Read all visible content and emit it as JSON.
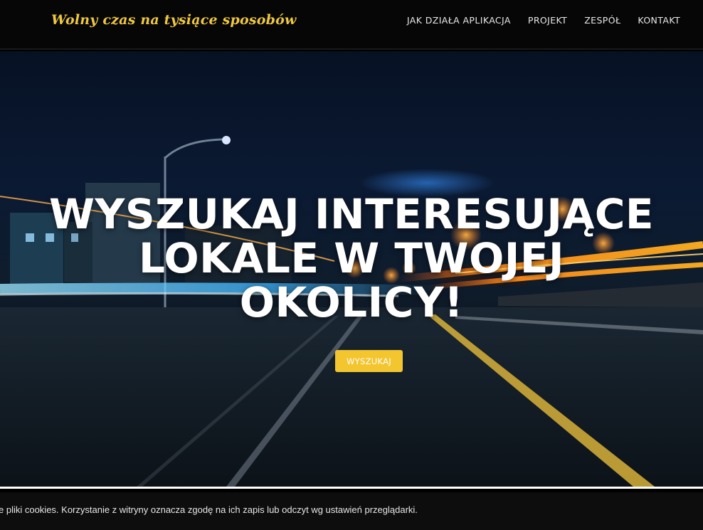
{
  "header": {
    "brand": "Wolny czas na tysiące sposobów",
    "nav": [
      "JAK DZIAŁA APLIKACJA",
      "PROJEKT",
      "ZESPÓŁ",
      "KONTAKT"
    ]
  },
  "hero": {
    "title_lines": [
      "WYSZUKAJ INTERESUJĄCE",
      "LOKALE W TWOJEJ",
      "OKOLICY!"
    ],
    "button_label": "WYSZUKAJ"
  },
  "cookie_bar": {
    "text": "e pliki cookies. Korzystanie z witryny oznacza zgodę na ich zapis lub odczyt wg ustawień przeglądarki."
  },
  "colors": {
    "brand": "#f0c83e",
    "button": "#f3c52f",
    "navbar_bg": "#060606",
    "cookie_bg": "#0d0d0d"
  }
}
